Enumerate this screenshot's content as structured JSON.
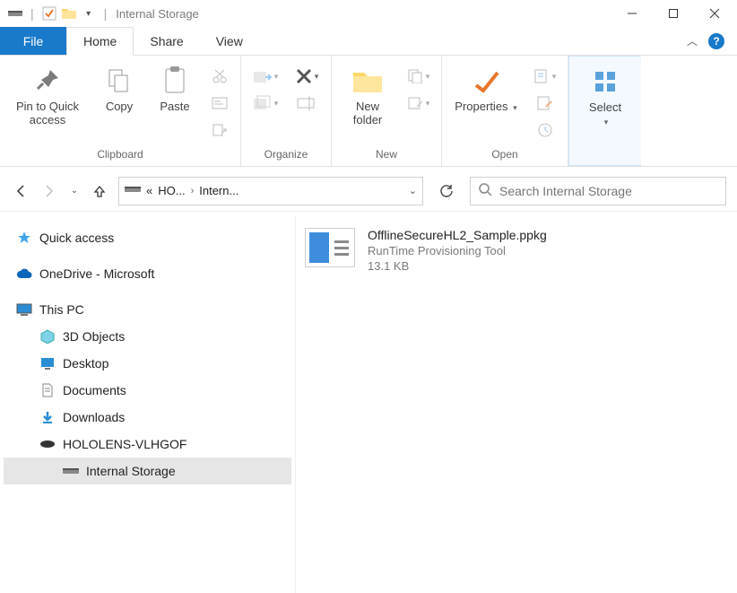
{
  "window": {
    "title": "Internal Storage"
  },
  "tabs": {
    "file": "File",
    "home": "Home",
    "share": "Share",
    "view": "View"
  },
  "ribbon": {
    "clipboard": {
      "label": "Clipboard",
      "pin": "Pin to Quick access",
      "copy": "Copy",
      "paste": "Paste"
    },
    "organize": {
      "label": "Organize"
    },
    "newgrp": {
      "label": "New",
      "newfolder": "New folder"
    },
    "open": {
      "label": "Open",
      "properties": "Properties"
    },
    "select": {
      "label": "Select"
    }
  },
  "address": {
    "c1": "«",
    "c2": "HO...",
    "c3": "Intern..."
  },
  "search": {
    "placeholder": "Search Internal Storage"
  },
  "tree": {
    "quick": "Quick access",
    "onedrive": "OneDrive - Microsoft",
    "thispc": "This PC",
    "obj3d": "3D Objects",
    "desktop": "Desktop",
    "documents": "Documents",
    "downloads": "Downloads",
    "hololens": "HOLOLENS-VLHGOF",
    "internal": "Internal Storage"
  },
  "file": {
    "name": "OfflineSecureHL2_Sample.ppkg",
    "type": "RunTime Provisioning Tool",
    "size": "13.1 KB"
  }
}
